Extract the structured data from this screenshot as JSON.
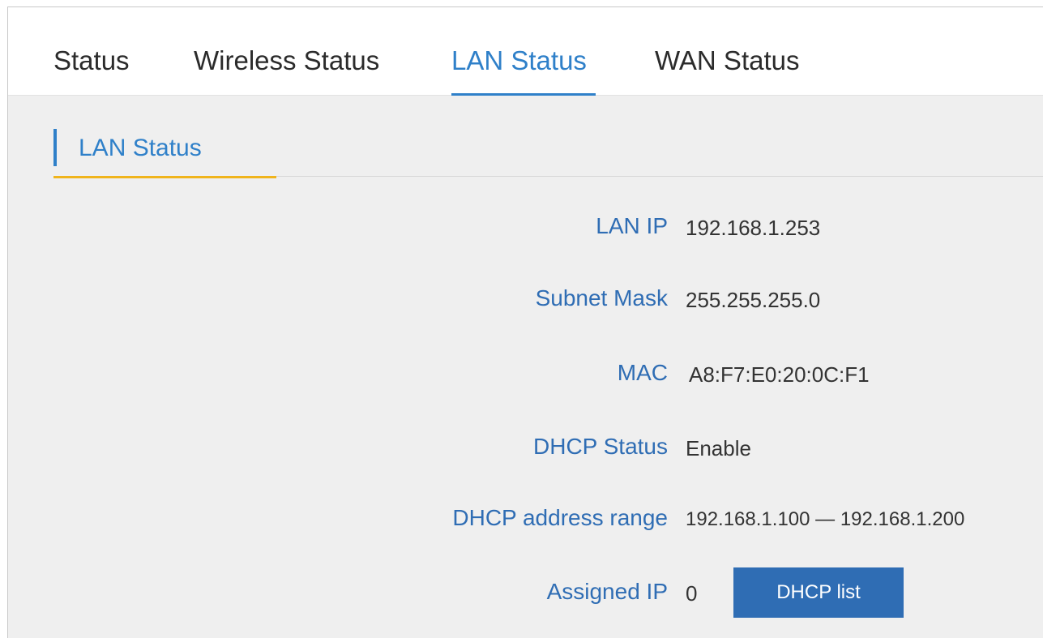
{
  "tabs": [
    {
      "label": "Status",
      "active": false
    },
    {
      "label": "Wireless Status",
      "active": false
    },
    {
      "label": "LAN Status",
      "active": true
    },
    {
      "label": "WAN Status",
      "active": false
    }
  ],
  "section": {
    "title": "LAN Status"
  },
  "fields": {
    "lan_ip": {
      "label": "LAN IP",
      "value": "192.168.1.253"
    },
    "subnet_mask": {
      "label": "Subnet Mask",
      "value": "255.255.255.0"
    },
    "mac": {
      "label": "MAC",
      "value": "A8:F7:E0:20:0C:F1"
    },
    "dhcp_status": {
      "label": "DHCP Status",
      "value": "Enable"
    },
    "dhcp_range": {
      "label": "DHCP address range",
      "value": "192.168.1.100 — 192.168.1.200"
    },
    "assigned_ip": {
      "label": "Assigned IP",
      "value": "0"
    }
  },
  "buttons": {
    "dhcp_list": "DHCP list"
  },
  "colors": {
    "accent_blue": "#2f80c9",
    "label_blue": "#2f6db4",
    "underline_yellow": "#f0b41c",
    "button_blue": "#2f6db4"
  }
}
